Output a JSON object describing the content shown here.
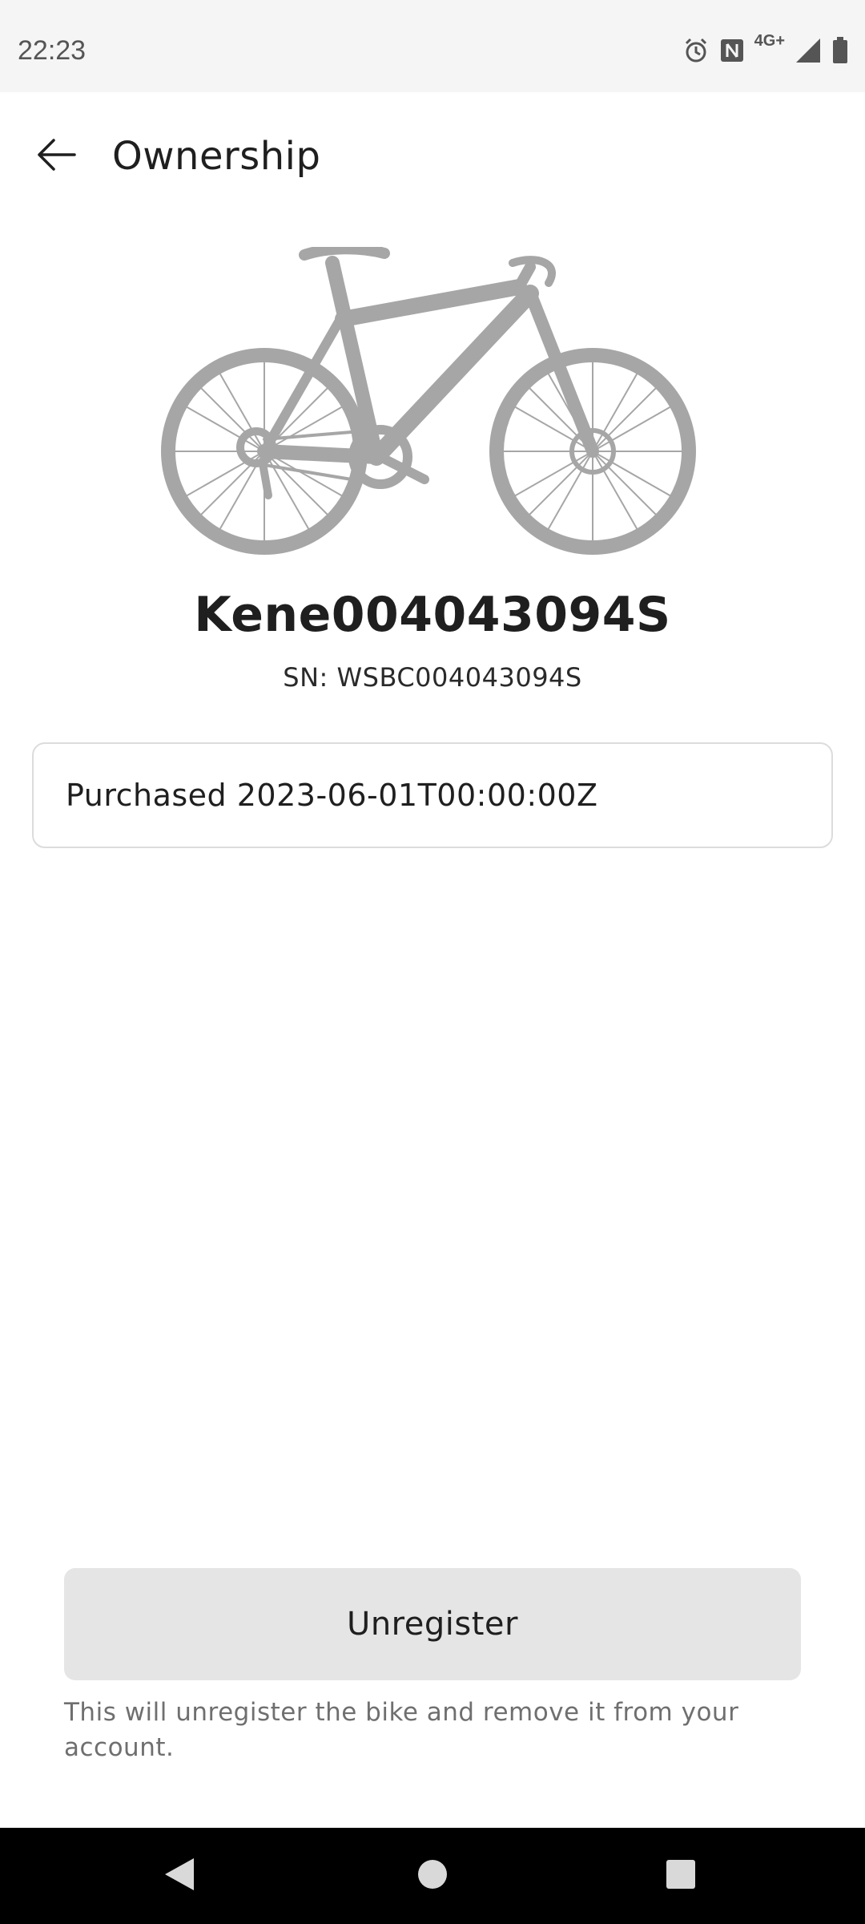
{
  "status_bar": {
    "time": "22:23",
    "network_label": "4G+",
    "icons": [
      "alarm-icon",
      "nfc-icon",
      "signal-icon",
      "battery-icon"
    ]
  },
  "header": {
    "title": "Ownership",
    "back_icon": "arrow-left-icon"
  },
  "bike": {
    "image_icon": "bicycle-silhouette",
    "name": "Kene004043094S",
    "serial": "SN: WSBC004043094S"
  },
  "purchase": {
    "label": "Purchased 2023-06-01T00:00:00Z"
  },
  "actions": {
    "unregister_label": "Unregister",
    "unregister_note": "This will unregister the bike and remove it from your account."
  },
  "nav": {
    "icons": [
      "back-triangle-icon",
      "home-circle-icon",
      "recents-square-icon"
    ]
  },
  "colors": {
    "status_bar_bg": "#f5f5f5",
    "bike_silhouette": "#a6a6a6",
    "button_bg": "#e5e5e5",
    "nav_bar_bg": "#000000"
  }
}
